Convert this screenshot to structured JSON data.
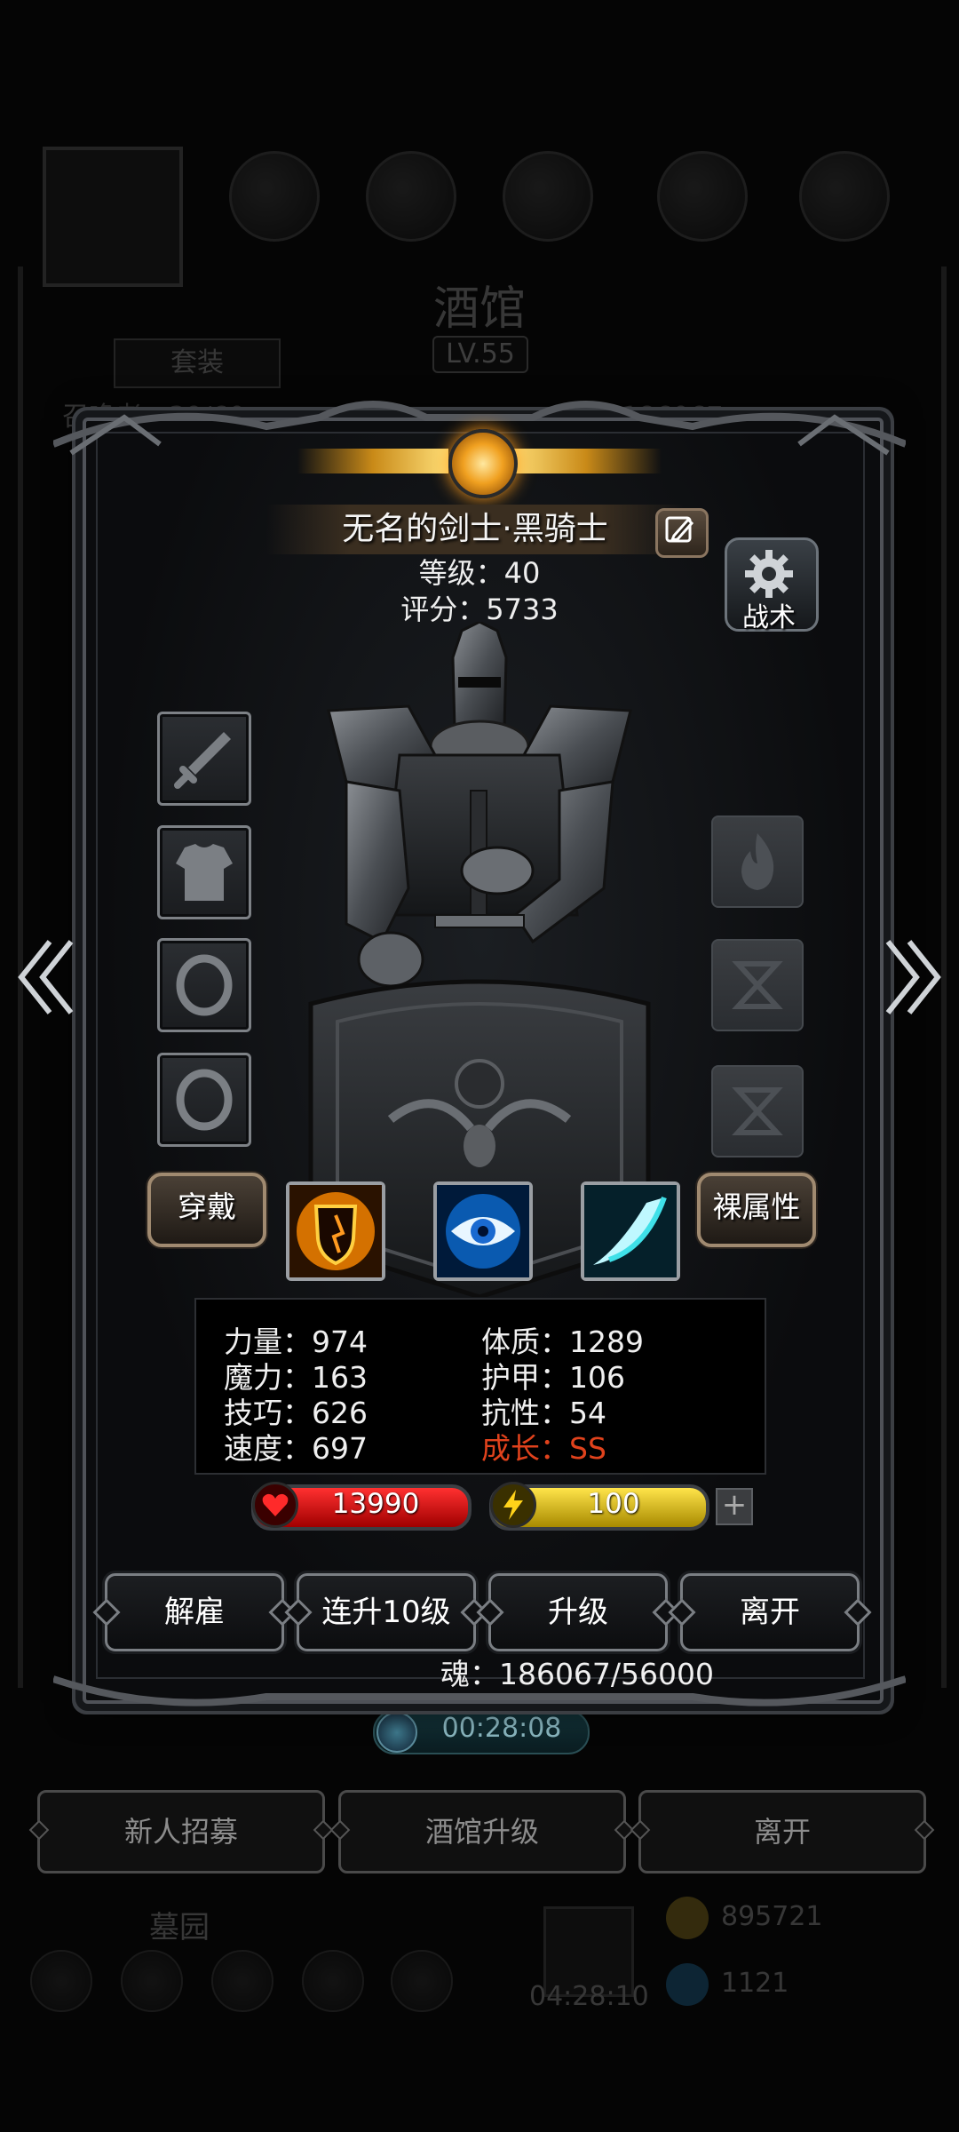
{
  "background": {
    "title": "酒馆",
    "level": "LV.55",
    "tabs": [
      "套装"
    ],
    "left_counter": "召唤者：39/60",
    "right_counter": "魂：186067",
    "timer": "00:28:08",
    "buttons": [
      "新人招募",
      "酒馆升级",
      "离开"
    ],
    "bottom_label": "墓园",
    "bottom_timer": "04:28:10",
    "gold": "895721",
    "gems": "1121"
  },
  "hero": {
    "name": "无名的剑士·黑骑士",
    "level": "等级：40",
    "score": "评分：5733"
  },
  "tactic": {
    "label": "战术"
  },
  "equipment_slots": [
    "sword-icon",
    "armor-icon",
    "ring-icon",
    "ring-icon"
  ],
  "rune_slots": [
    "flame-icon",
    "hourglass-icon",
    "hourglass-icon"
  ],
  "buttons": {
    "wear": "穿戴",
    "raw_stats": "裸属性"
  },
  "skills": [
    "fire-shield-icon",
    "eye-icon",
    "slash-icon"
  ],
  "stats": {
    "strength": "力量：974",
    "magic": "魔力：163",
    "skill": "技巧：626",
    "speed": "速度：697",
    "constitution": "体质：1289",
    "armor": "护甲：106",
    "resistance": "抗性：54",
    "growth": "成长：SS"
  },
  "bars": {
    "hp": "13990",
    "energy": "100"
  },
  "actions": {
    "dismiss": "解雇",
    "level_up_10": "连升10级",
    "level_up": "升级",
    "leave": "离开"
  },
  "soul": "魂：186067/56000",
  "colors": {
    "growth": "#e0421c",
    "hp": "#d81414",
    "energy": "#e0c21a",
    "accent_gold": "#f0a020"
  }
}
